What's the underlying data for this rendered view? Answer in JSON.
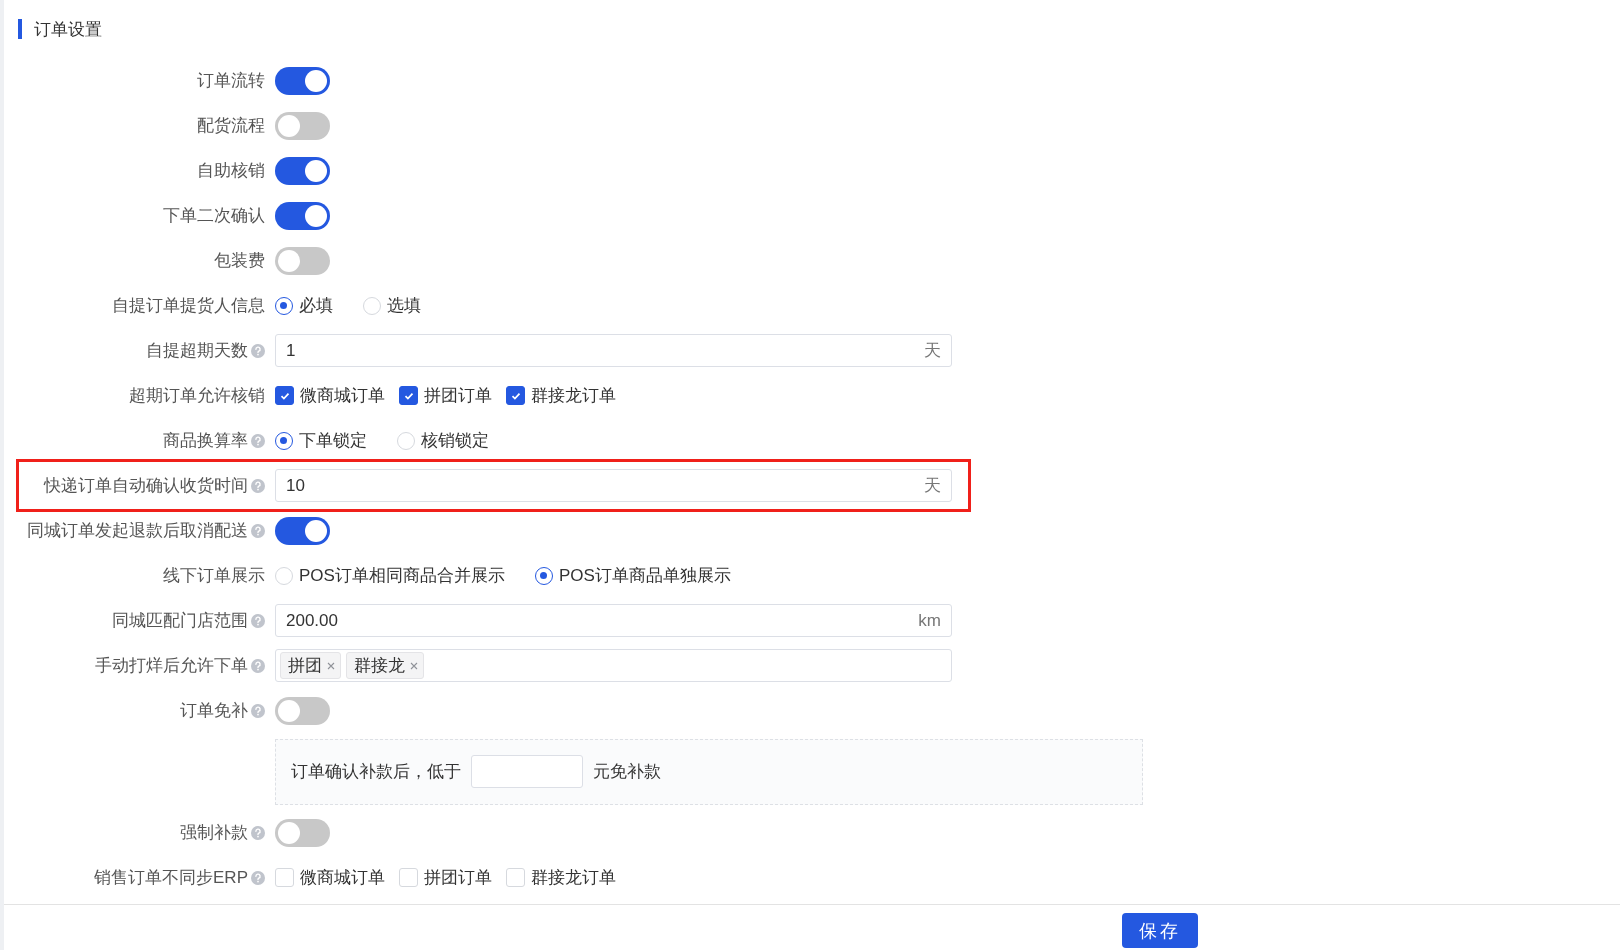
{
  "section_title": "订单设置",
  "rows": [
    {
      "kind": "switch",
      "label": "订单流转",
      "help": false,
      "highlighted": false,
      "on": true
    },
    {
      "kind": "switch",
      "label": "配货流程",
      "help": false,
      "highlighted": false,
      "on": false
    },
    {
      "kind": "switch",
      "label": "自助核销",
      "help": false,
      "highlighted": false,
      "on": true
    },
    {
      "kind": "switch",
      "label": "下单二次确认",
      "help": false,
      "highlighted": false,
      "on": true
    },
    {
      "kind": "switch",
      "label": "包装费",
      "help": false,
      "highlighted": false,
      "on": false
    },
    {
      "kind": "radio",
      "label": "自提订单提货人信息",
      "help": false,
      "highlighted": false,
      "options": [
        {
          "label": "必填",
          "selected": true
        },
        {
          "label": "选填",
          "selected": false
        }
      ]
    },
    {
      "kind": "input",
      "label": "自提超期天数",
      "help": true,
      "highlighted": false,
      "value": "1",
      "suffix": "天"
    },
    {
      "kind": "checkbox",
      "label": "超期订单允许核销",
      "help": false,
      "highlighted": false,
      "options": [
        {
          "label": "微商城订单",
          "checked": true
        },
        {
          "label": "拼团订单",
          "checked": true
        },
        {
          "label": "群接龙订单",
          "checked": true
        }
      ]
    },
    {
      "kind": "radio",
      "label": "商品换算率",
      "help": true,
      "highlighted": false,
      "options": [
        {
          "label": "下单锁定",
          "selected": true
        },
        {
          "label": "核销锁定",
          "selected": false
        }
      ]
    },
    {
      "kind": "input",
      "label": "快递订单自动确认收货时间",
      "help": true,
      "highlighted": true,
      "value": "10",
      "suffix": "天"
    },
    {
      "kind": "switch",
      "label": "同城订单发起退款后取消配送",
      "help": true,
      "highlighted": false,
      "on": true
    },
    {
      "kind": "radio",
      "label": "线下订单展示",
      "help": false,
      "highlighted": false,
      "options": [
        {
          "label": "POS订单相同商品合并展示",
          "selected": false
        },
        {
          "label": "POS订单商品单独展示",
          "selected": true
        }
      ]
    },
    {
      "kind": "input",
      "label": "同城匹配门店范围",
      "help": true,
      "highlighted": false,
      "value": "200.00",
      "suffix": "km"
    },
    {
      "kind": "tags",
      "label": "手动打烊后允许下单",
      "help": true,
      "highlighted": false,
      "tags": [
        "拼团",
        "群接龙"
      ]
    },
    {
      "kind": "switch",
      "label": "订单免补",
      "help": true,
      "highlighted": false,
      "on": false
    },
    {
      "kind": "note",
      "before": "订单确认补款后，低于",
      "after": "元免补款",
      "highlighted": false
    },
    {
      "kind": "switch",
      "label": "强制补款",
      "help": true,
      "highlighted": false,
      "on": false
    },
    {
      "kind": "checkbox",
      "label": "销售订单不同步ERP",
      "help": true,
      "highlighted": false,
      "options": [
        {
          "label": "微商城订单",
          "checked": false
        },
        {
          "label": "拼团订单",
          "checked": false
        },
        {
          "label": "群接龙订单",
          "checked": false
        }
      ]
    }
  ],
  "save_button": "保存"
}
